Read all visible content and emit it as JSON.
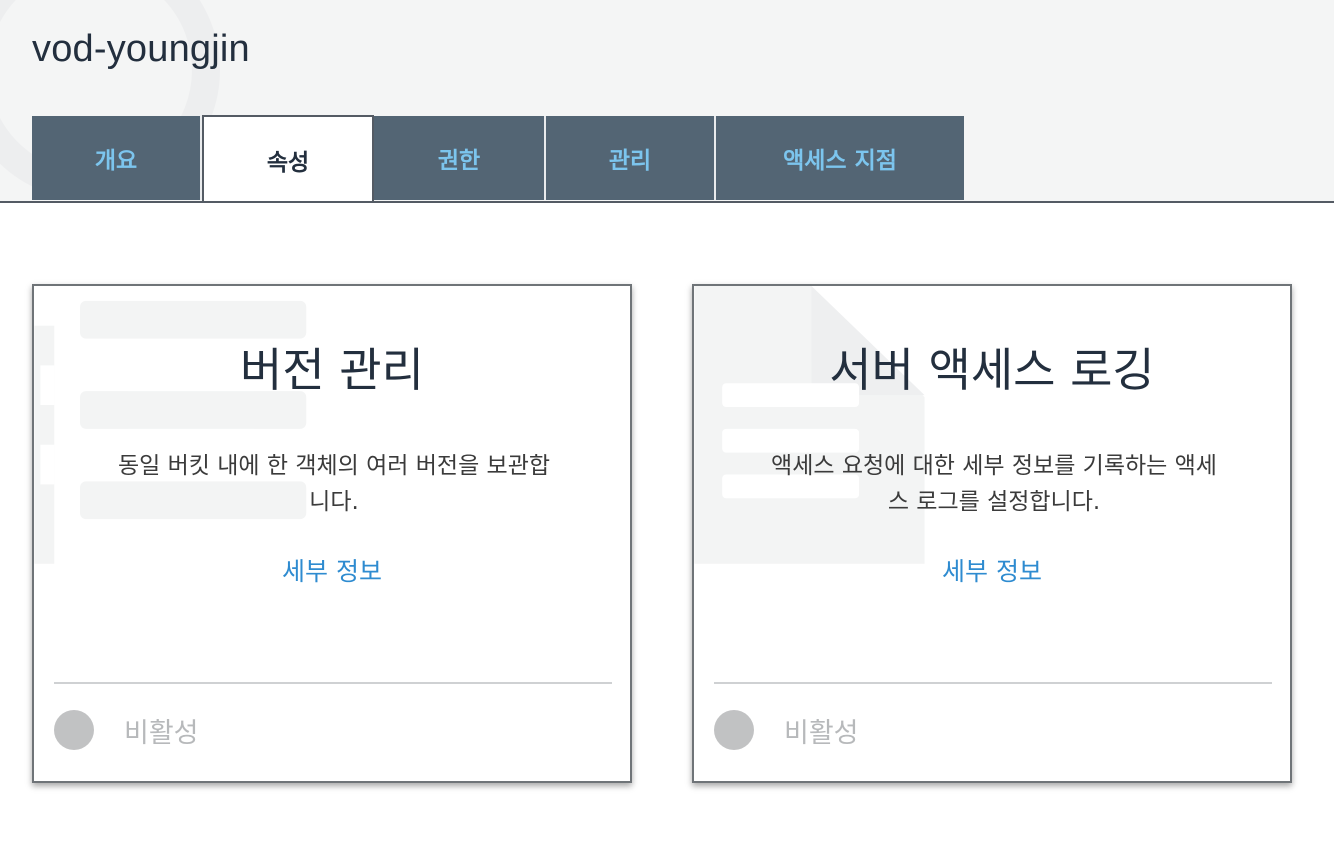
{
  "bucket": {
    "title": "vod-youngjin"
  },
  "tabs": [
    {
      "label": "개요",
      "active": false
    },
    {
      "label": "속성",
      "active": true
    },
    {
      "label": "권한",
      "active": false
    },
    {
      "label": "관리",
      "active": false
    },
    {
      "label": "액세스 지점",
      "active": false
    }
  ],
  "cards": [
    {
      "title": "버전 관리",
      "description_line1": "동일 버킷 내에 한 객체의 여러 버전을 보관합",
      "description_line2": "니다.",
      "link": "세부 정보",
      "status": "비활성",
      "icon": "version-stack-icon"
    },
    {
      "title": "서버 액세스 로깅",
      "description_line1": "액세스 요청에 대한 세부 정보를 기록하는 액세",
      "description_line2": "스 로그를 설정합니다.",
      "link": "세부 정보",
      "status": "비활성",
      "icon": "log-document-icon"
    }
  ],
  "colors": {
    "tab_inactive_bg": "#536574",
    "tab_inactive_text": "#7cc5ee",
    "link": "#2e8bd0",
    "status_inactive": "#c1c2c3"
  }
}
